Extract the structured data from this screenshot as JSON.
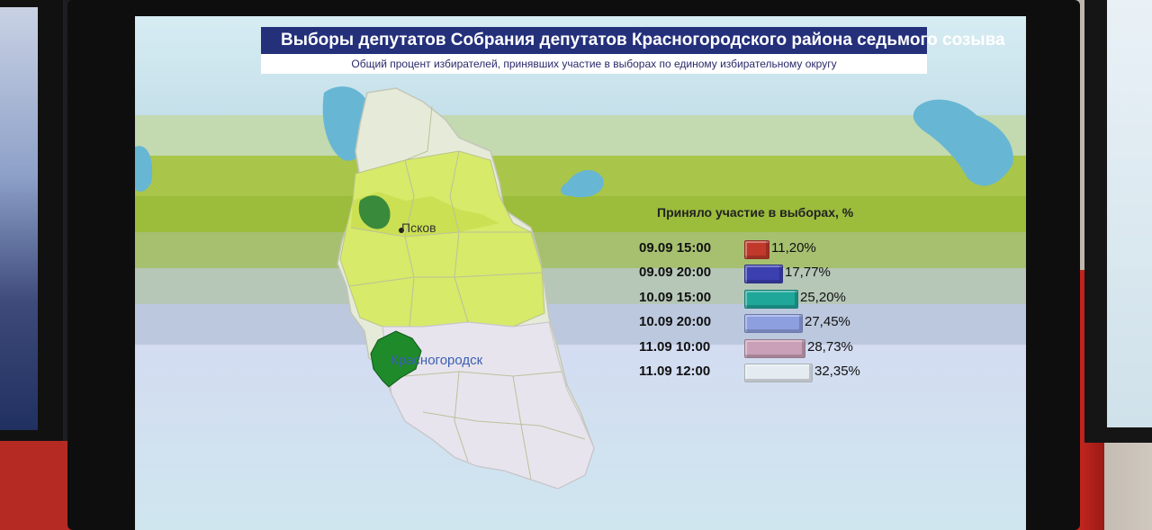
{
  "title": "Выборы депутатов Собрания депутатов Красногородского района седьмого созыва",
  "subtitle": "Общий процент избирателей, принявших участие в выборах по единому избирательному округу",
  "map": {
    "labels": {
      "pskov": "Псков",
      "krasnogorodsk": "Красногородск"
    }
  },
  "chart_data": {
    "type": "bar",
    "title": "Приняло участие в выборах, %",
    "categories": [
      "09.09 15:00",
      "09.09 20:00",
      "10.09 15:00",
      "10.09 20:00",
      "11.09 10:00",
      "11.09 12:00"
    ],
    "values": [
      11.2,
      17.77,
      25.2,
      27.45,
      28.73,
      32.35
    ],
    "value_labels": [
      "11,20%",
      "17,77%",
      "25,20%",
      "27,45%",
      "28,73%",
      "32,35%"
    ],
    "colors": [
      "#c0392b",
      "#3b3fb0",
      "#1fa79a",
      "#8e9fe0",
      "#c9a0b8",
      "#e4ecf2"
    ],
    "orientation": "horizontal",
    "xlim": [
      0,
      35
    ]
  }
}
